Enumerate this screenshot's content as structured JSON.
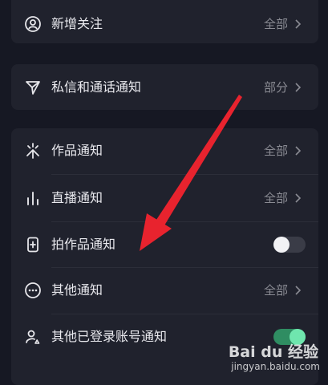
{
  "rows": [
    {
      "label": "新增关注",
      "value": "全部",
      "icon": "user-circle-icon"
    },
    {
      "label": "私信和通话通知",
      "value": "部分",
      "icon": "send-icon"
    },
    {
      "label": "作品通知",
      "value": "全部",
      "icon": "spark-icon"
    },
    {
      "label": "直播通知",
      "value": "全部",
      "icon": "bars-icon"
    },
    {
      "label": "拍作品通知",
      "icon": "camera-phone-icon",
      "toggle": "off"
    },
    {
      "label": "其他通知",
      "value": "全部",
      "icon": "more-circle-icon"
    },
    {
      "label": "其他已登录账号通知",
      "icon": "account-switch-icon",
      "toggle": "on"
    }
  ],
  "colors": {
    "background": "#161823",
    "card": "#20222d",
    "arrow": "#e8232e",
    "toggle_on": "#6fe6ae"
  },
  "watermark": {
    "brand": "Bai du 经验",
    "url": "jingyan.baidu.com"
  }
}
